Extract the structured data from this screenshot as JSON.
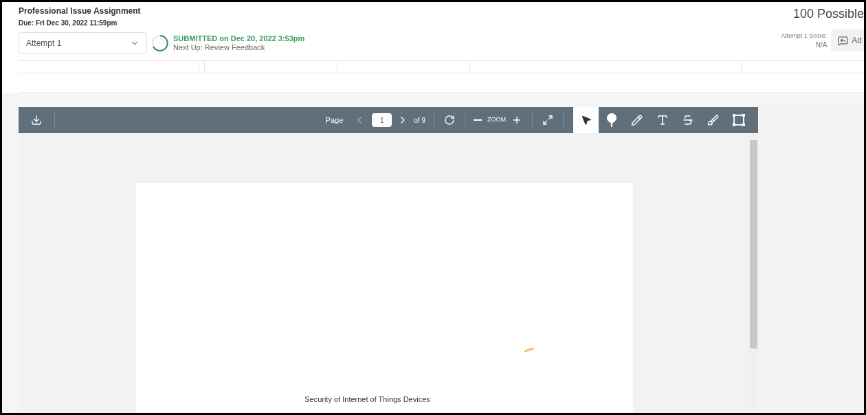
{
  "assignment": {
    "title": "Professional Issue Assignment",
    "due": "Due: Fri Dec 30, 2022 11:59pm"
  },
  "attempt_select": {
    "value": "Attempt 1"
  },
  "status": {
    "headline": "SUBMITTED on Dec 20, 2022 3:53pm",
    "next": "Next Up: Review Feedback"
  },
  "points": "100 Possible",
  "score": {
    "label": "Attempt 1 Score:",
    "value": "N/A"
  },
  "feedback_button": "Ad",
  "toolbar": {
    "page_label": "Page",
    "page_value": "1",
    "page_total": "of 9",
    "zoom_label": "ZOOM",
    "tools": [
      {
        "kind": "select",
        "selected": true
      },
      {
        "kind": "pin",
        "selected": false
      },
      {
        "kind": "pen",
        "selected": false
      },
      {
        "kind": "text",
        "selected": false
      },
      {
        "kind": "strike",
        "selected": false
      },
      {
        "kind": "brush",
        "selected": false
      },
      {
        "kind": "area",
        "selected": false
      }
    ]
  },
  "document": {
    "text": "Security of Internet of Things Devices"
  }
}
